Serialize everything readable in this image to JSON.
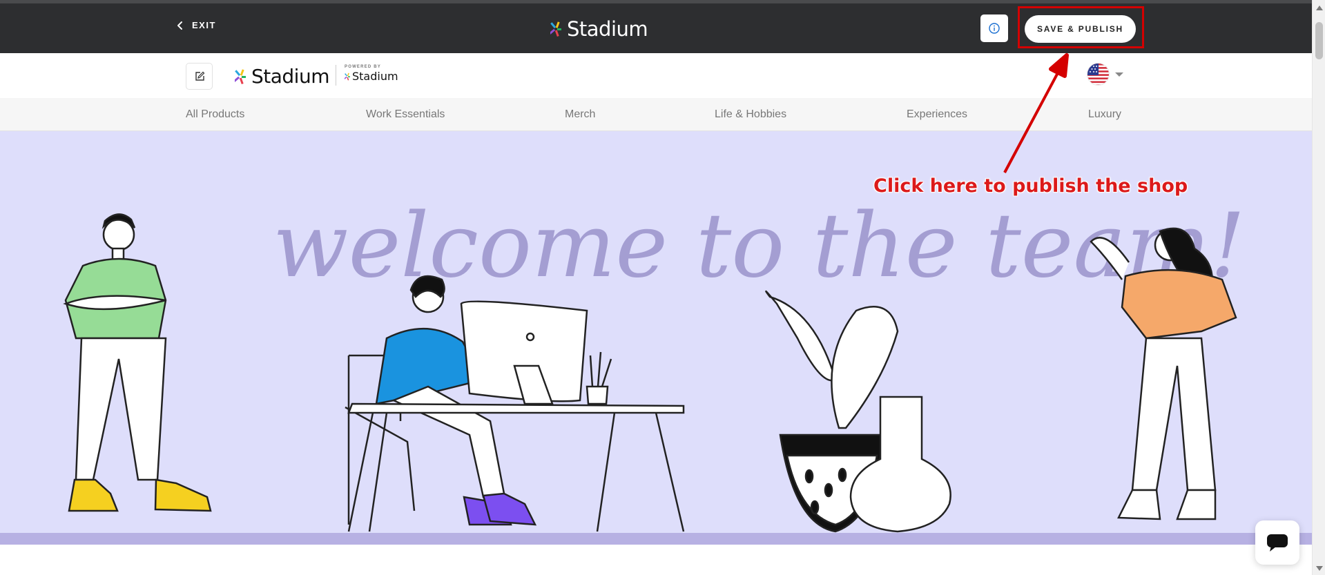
{
  "editor_bar": {
    "exit_label": "EXIT",
    "brand": "Stadium",
    "info_icon": "info-icon",
    "publish_label": "SAVE & PUBLISH"
  },
  "shop_header": {
    "brand": "Stadium",
    "powered_by_label": "POWERED BY",
    "powered_by_brand": "Stadium",
    "locale_flag": "us-flag-icon"
  },
  "categories": [
    "All Products",
    "Work Essentials",
    "Merch",
    "Life & Hobbies",
    "Experiences",
    "Luxury"
  ],
  "hero": {
    "headline": "welcome to the team!"
  },
  "annotation": {
    "text": "Click here to publish the shop"
  },
  "colors": {
    "top_bar": "#2d2e30",
    "hero_background": "#dedefb",
    "hero_band": "#b7b1e3",
    "headline": "#a49ed2",
    "annotation_red": "#dc1a1a"
  }
}
